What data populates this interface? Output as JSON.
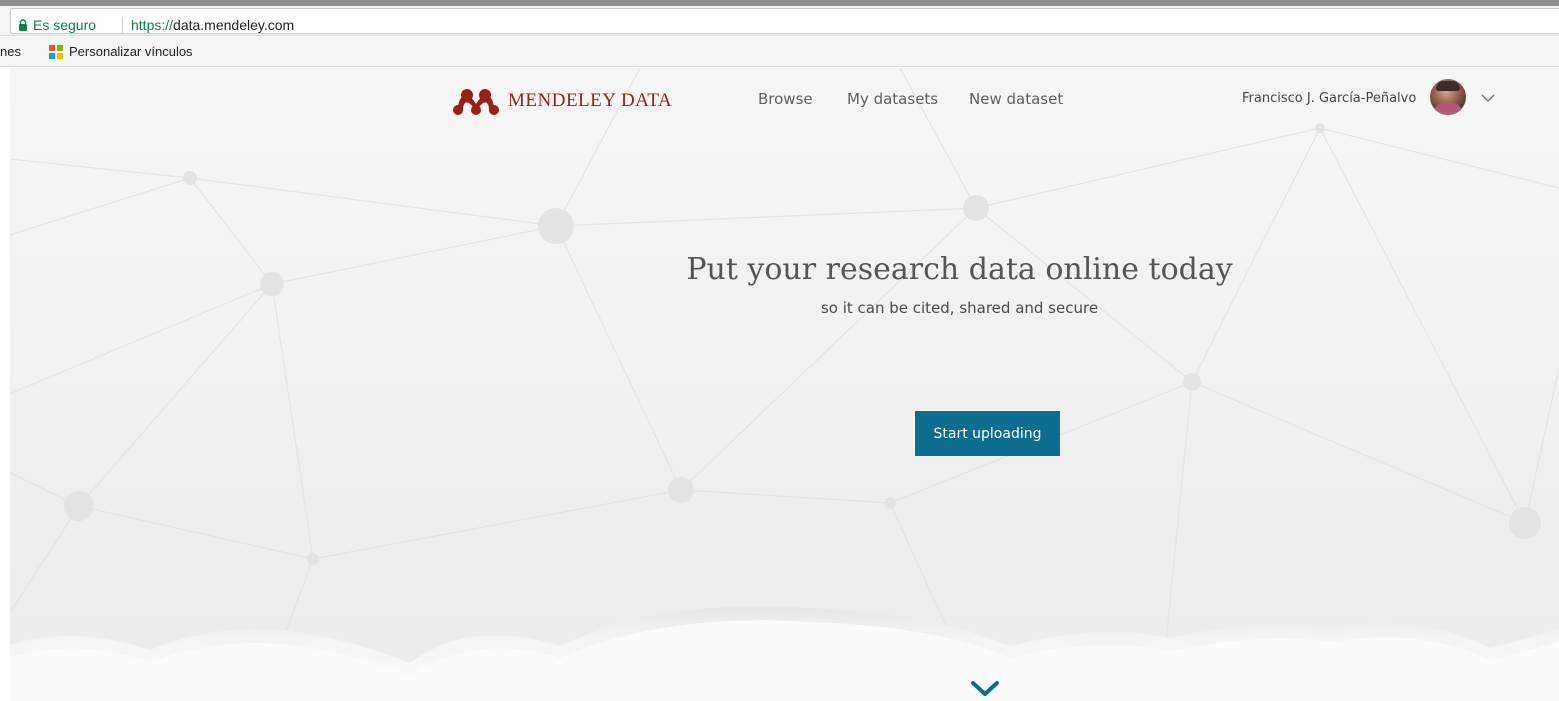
{
  "browser": {
    "secure_label": "Es seguro",
    "url_scheme": "https://",
    "url_host": "data.mendeley.com",
    "bookmarks": {
      "apps_label": "nes",
      "personalizar_label": "Personalizar vínculos",
      "personalizar_icon": "microsoft-windows-icon"
    }
  },
  "header": {
    "logo_text": "MENDELEY DATA",
    "nav": {
      "browse": "Browse",
      "my_datasets": "My datasets",
      "new_dataset": "New dataset"
    },
    "user_name": "Francisco J. García-Peñalvo"
  },
  "hero": {
    "title": "Put your research data online today",
    "subtitle": "so it can be cited, shared and secure",
    "cta_label": "Start uploading"
  },
  "colors": {
    "brand_red": "#9a1f14",
    "cta_blue": "#0c6d8e",
    "secure_green": "#0b8043"
  },
  "icons": {
    "secure": "lock-icon",
    "account_menu": "chevron-down-icon",
    "scroll": "scroll-down-chevron-icon"
  }
}
